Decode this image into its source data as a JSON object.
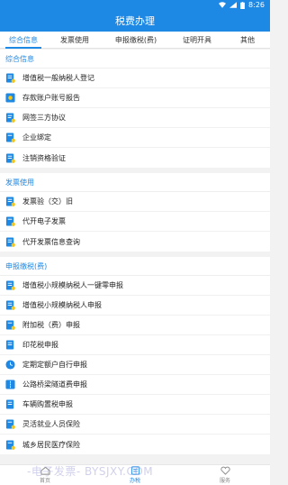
{
  "status_bar": {
    "time": "8:26"
  },
  "header": {
    "title": "税费办理"
  },
  "tabs": [
    {
      "label": "综合信息",
      "active": true
    },
    {
      "label": "发票使用",
      "active": false
    },
    {
      "label": "申报缴税(费)",
      "active": false
    },
    {
      "label": "证明开具",
      "active": false
    },
    {
      "label": "其他",
      "active": false
    }
  ],
  "sections": [
    {
      "title": "综合信息",
      "items": [
        {
          "label": "增值税一般纳税人登记",
          "icon": "document-icon"
        },
        {
          "label": "存款账户账号报告",
          "icon": "account-icon"
        },
        {
          "label": "网签三方协议",
          "icon": "agreement-icon"
        },
        {
          "label": "企业绑定",
          "icon": "bind-icon"
        },
        {
          "label": "注销资格验证",
          "icon": "verify-icon"
        }
      ]
    },
    {
      "title": "发票使用",
      "items": [
        {
          "label": "发票验（交）旧",
          "icon": "invoice-icon"
        },
        {
          "label": "代开电子发票",
          "icon": "e-invoice-icon"
        },
        {
          "label": "代开发票信息查询",
          "icon": "invoice-query-icon"
        }
      ]
    },
    {
      "title": "申报缴税(费)",
      "items": [
        {
          "label": "增值税小规模纳税人一键零申报",
          "icon": "declare-icon"
        },
        {
          "label": "增值税小规模纳税人申报",
          "icon": "declare-icon"
        },
        {
          "label": "附加税（费）申报",
          "icon": "declare-icon"
        },
        {
          "label": "印花税申报",
          "icon": "stamp-icon"
        },
        {
          "label": "定期定额户自行申报",
          "icon": "clock-icon"
        },
        {
          "label": "公路桥梁隧道费申报",
          "icon": "road-icon"
        },
        {
          "label": "车辆购置税申报",
          "icon": "vehicle-icon"
        },
        {
          "label": "灵活就业人员保险",
          "icon": "insurance-icon"
        },
        {
          "label": "城乡居民医疗保险",
          "icon": "medical-icon"
        }
      ]
    }
  ],
  "bottom_nav": [
    {
      "label": "首页",
      "icon": "home-icon",
      "active": false
    },
    {
      "label": "办税",
      "icon": "tax-icon",
      "active": true
    },
    {
      "label": "服务",
      "icon": "heart-icon",
      "active": false
    }
  ],
  "watermark": "-电子发票- BYSJXY.COM",
  "colors": {
    "primary": "#1e88e5",
    "icon_accent": "#f5c518"
  }
}
